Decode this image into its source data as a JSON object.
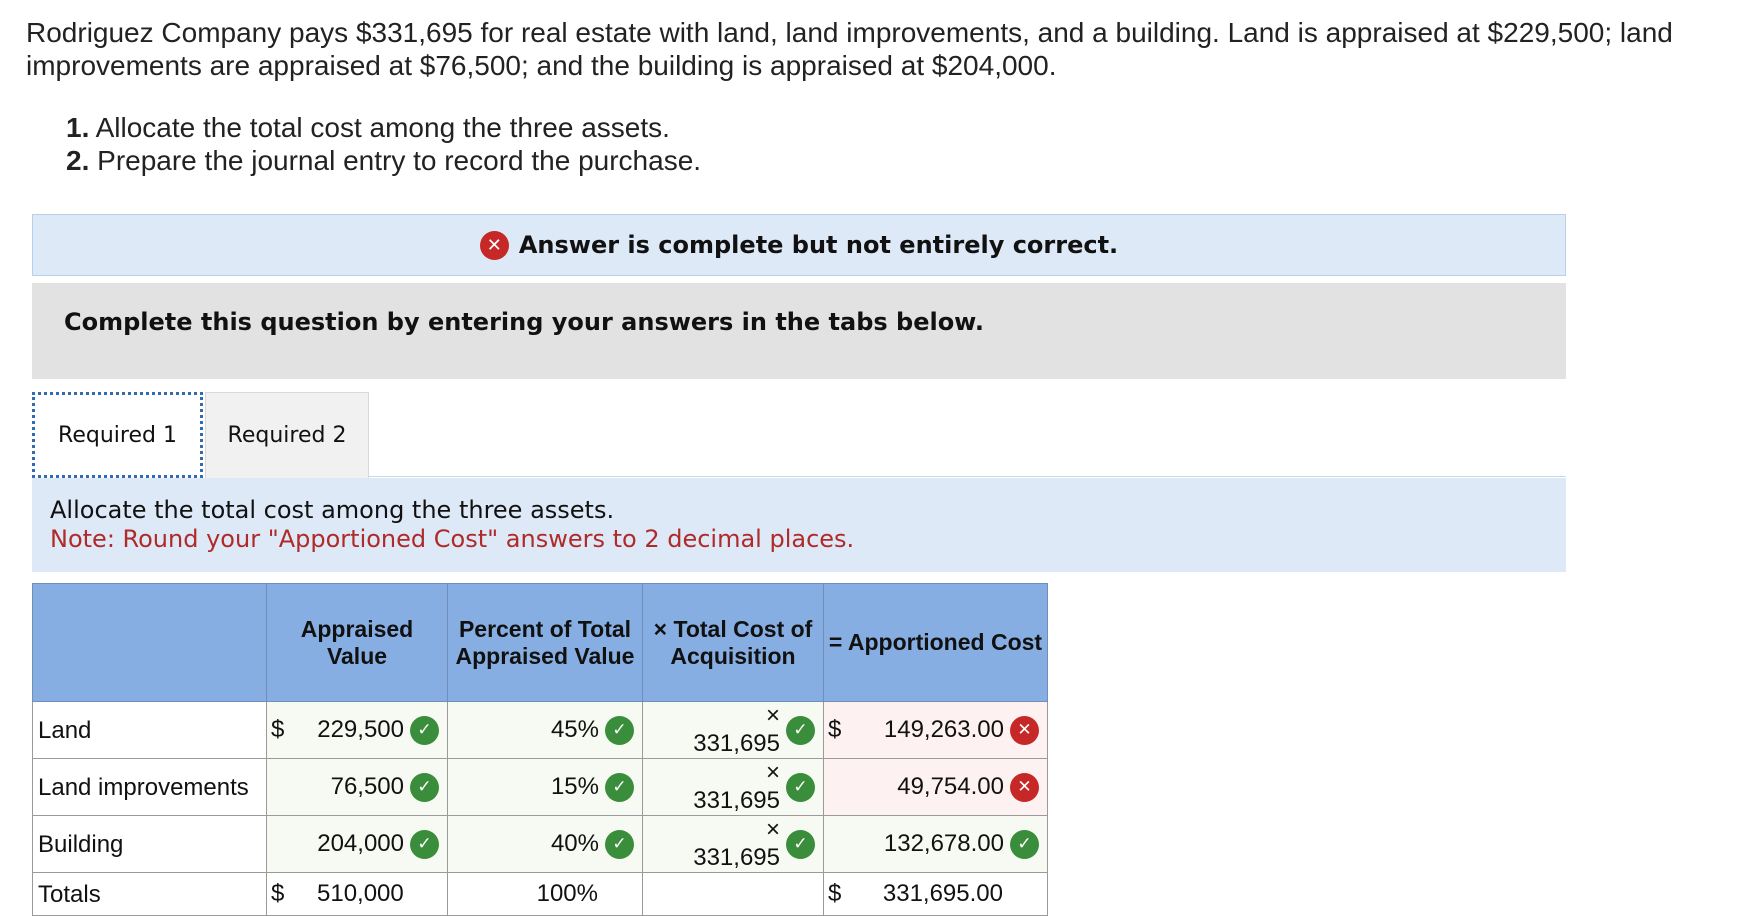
{
  "prompt": {
    "text": "Rodriguez Company pays $331,695 for real estate with land, land improvements, and a building. Land is appraised at $229,500; land improvements are appraised at $76,500; and the building is appraised at $204,000."
  },
  "steps": [
    {
      "num": "1.",
      "text": "Allocate the total cost among the three assets."
    },
    {
      "num": "2.",
      "text": "Prepare the journal entry to record the purchase."
    }
  ],
  "banner": {
    "text": "Answer is complete but not entirely correct."
  },
  "instruction_box": {
    "text": "Complete this question by entering your answers in the tabs below."
  },
  "tabs": [
    {
      "label": "Required 1",
      "active": true
    },
    {
      "label": "Required 2",
      "active": false
    }
  ],
  "task": {
    "text": "Allocate the total cost among the three assets.",
    "note": "Note: Round your \"Apportioned Cost\" answers to 2 decimal places."
  },
  "table": {
    "headers": [
      "",
      "Appraised Value",
      "Percent of Total Appraised Value",
      "× Total Cost of Acquisition",
      "= Apportioned Cost"
    ],
    "rows": [
      {
        "label": "Land",
        "appraised_dollar": "$",
        "appraised": "229,500",
        "appraised_status": "correct",
        "percent": "45%",
        "percent_status": "correct",
        "total_cost": "× 331,695",
        "total_cost_status": "correct",
        "apportioned_dollar": "$",
        "apportioned": "149,263.00",
        "apportioned_status": "incorrect"
      },
      {
        "label": "Land improvements",
        "appraised_dollar": "",
        "appraised": "76,500",
        "appraised_status": "correct",
        "percent": "15%",
        "percent_status": "correct",
        "total_cost": "× 331,695",
        "total_cost_status": "correct",
        "apportioned_dollar": "",
        "apportioned": "49,754.00",
        "apportioned_status": "incorrect"
      },
      {
        "label": "Building",
        "appraised_dollar": "",
        "appraised": "204,000",
        "appraised_status": "correct",
        "percent": "40%",
        "percent_status": "correct",
        "total_cost": "× 331,695",
        "total_cost_status": "correct",
        "apportioned_dollar": "",
        "apportioned": "132,678.00",
        "apportioned_status": "correct"
      }
    ],
    "totals": {
      "label": "Totals",
      "appraised_dollar": "$",
      "appraised": "510,000",
      "percent": "100%",
      "apportioned_dollar": "$",
      "apportioned": "331,695.00"
    }
  },
  "colors": {
    "correct": "#3a8d3a",
    "incorrect": "#c62828",
    "header_bg": "#86aee2",
    "banner_bg": "#dde9f7"
  },
  "icons": {
    "correct": "check-circle-icon",
    "incorrect": "x-circle-icon"
  }
}
